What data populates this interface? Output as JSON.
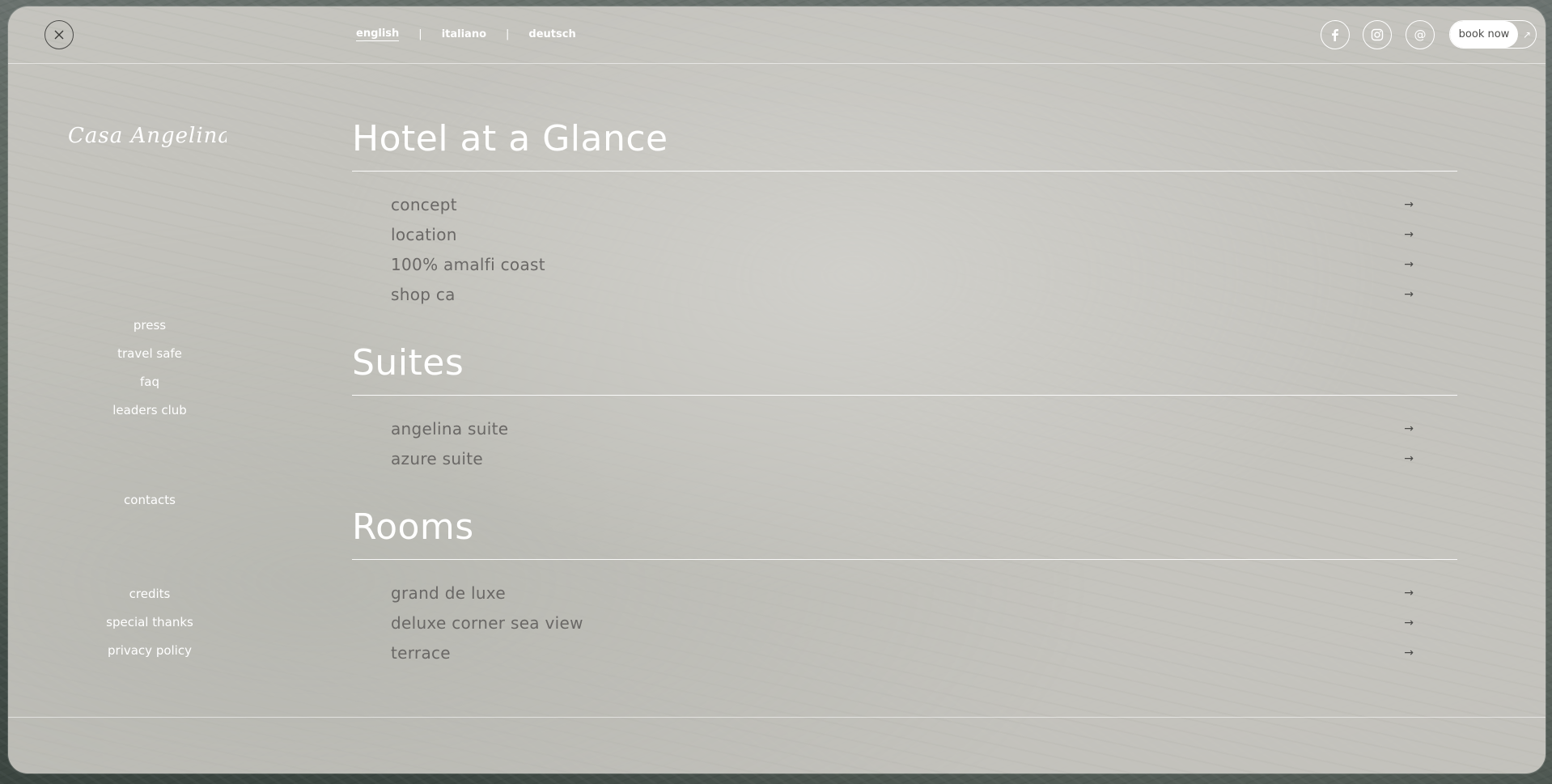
{
  "top": {
    "languages": [
      {
        "label": "english",
        "active": true
      },
      {
        "label": "italiano",
        "active": false
      },
      {
        "label": "deutsch",
        "active": false
      }
    ],
    "book_label": "book now"
  },
  "logo_text": "Casa Angelina",
  "left_menu": {
    "group1": [
      "press",
      "travel safe",
      "faq",
      "leaders club"
    ],
    "group2": [
      "contacts"
    ],
    "group3": [
      "credits",
      "special thanks",
      "privacy policy"
    ]
  },
  "sections": [
    {
      "title": "Hotel at a Glance",
      "items": [
        "concept",
        "location",
        "100% amalfi coast",
        "shop ca"
      ]
    },
    {
      "title": "Suites",
      "items": [
        "angelina suite",
        "azure suite"
      ]
    },
    {
      "title": "Rooms",
      "items": [
        "grand de luxe",
        "deluxe corner sea view",
        "terrace"
      ]
    }
  ],
  "icons": {
    "close": "close-icon",
    "arrow": "arrow-right-icon",
    "facebook": "facebook-icon",
    "instagram": "instagram-icon",
    "email": "at-icon",
    "external": "external-link-icon"
  }
}
